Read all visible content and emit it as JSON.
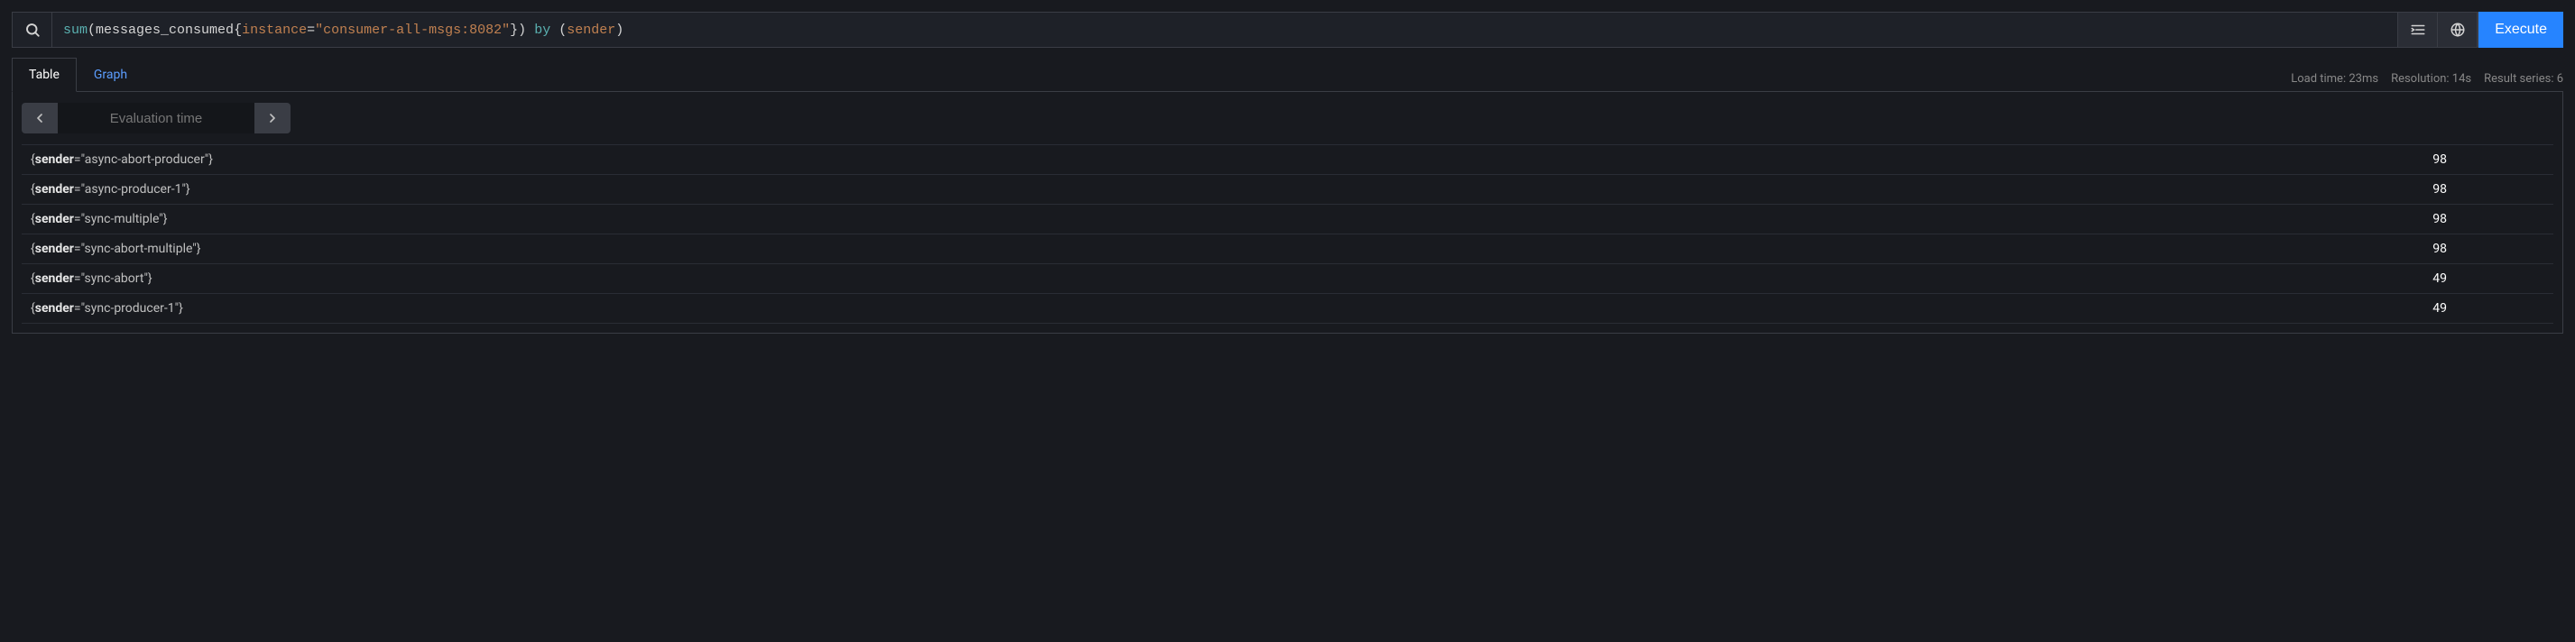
{
  "query": {
    "func": "sum",
    "metric": "messages_consumed",
    "label_key": "instance",
    "label_val": "\"consumer-all-msgs:8082\"",
    "op": "by",
    "group": "sender"
  },
  "execute_label": "Execute",
  "tabs": {
    "table": "Table",
    "graph": "Graph"
  },
  "stats": {
    "load_time": "Load time: 23ms",
    "resolution": "Resolution: 14s",
    "result_series": "Result series: 6"
  },
  "time_nav": {
    "placeholder": "Evaluation time"
  },
  "results": [
    {
      "key": "sender",
      "val": "\"async-abort-producer\"",
      "value": "98"
    },
    {
      "key": "sender",
      "val": "\"async-producer-1\"",
      "value": "98"
    },
    {
      "key": "sender",
      "val": "\"sync-multiple\"",
      "value": "98"
    },
    {
      "key": "sender",
      "val": "\"sync-abort-multiple\"",
      "value": "98"
    },
    {
      "key": "sender",
      "val": "\"sync-abort\"",
      "value": "49"
    },
    {
      "key": "sender",
      "val": "\"sync-producer-1\"",
      "value": "49"
    }
  ]
}
